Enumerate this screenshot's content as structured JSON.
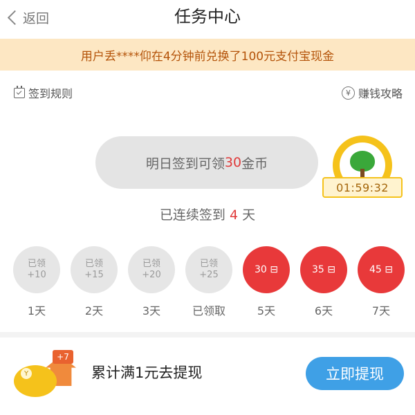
{
  "header": {
    "back_label": "返回",
    "title": "任务中心"
  },
  "notice": {
    "text": "用户丢****仰在4分钟前兑换了100元支付宝现金"
  },
  "links": {
    "rules": "签到规则",
    "strategy": "赚钱攻略"
  },
  "sign": {
    "prefix": "明日签到可领",
    "amount": "30",
    "suffix": "金币"
  },
  "timer": {
    "value": "01:59:32"
  },
  "streak": {
    "prefix": "已连续签到",
    "count": "4",
    "suffix": "天"
  },
  "days": [
    {
      "line1": "已领",
      "line2": "+10",
      "label": "1天",
      "state": "done"
    },
    {
      "line1": "已领",
      "line2": "+15",
      "label": "2天",
      "state": "done"
    },
    {
      "line1": "已领",
      "line2": "+20",
      "label": "3天",
      "state": "done"
    },
    {
      "line1": "已领",
      "line2": "+25",
      "label": "已领取",
      "state": "done"
    },
    {
      "line1": "30 ⊟",
      "line2": "",
      "label": "5天",
      "state": "todo"
    },
    {
      "line1": "35 ⊟",
      "line2": "",
      "label": "6天",
      "state": "todo"
    },
    {
      "line1": "45 ⊟",
      "line2": "",
      "label": "7天",
      "state": "todo"
    }
  ],
  "withdraw": {
    "text": "累计满1元去提现",
    "button": "立即提现",
    "icon_coin": "Y",
    "icon_plus": "+7"
  },
  "colors": {
    "accent_red": "#e8393a",
    "button_blue": "#3fa0e6",
    "notice_bg": "#fde7c3",
    "badge_gold": "#f5c21b"
  },
  "icons": [
    "back-chevron-icon",
    "calendar-check-icon",
    "yen-circle-icon",
    "tree-badge-icon",
    "piggy-bank-icon"
  ]
}
